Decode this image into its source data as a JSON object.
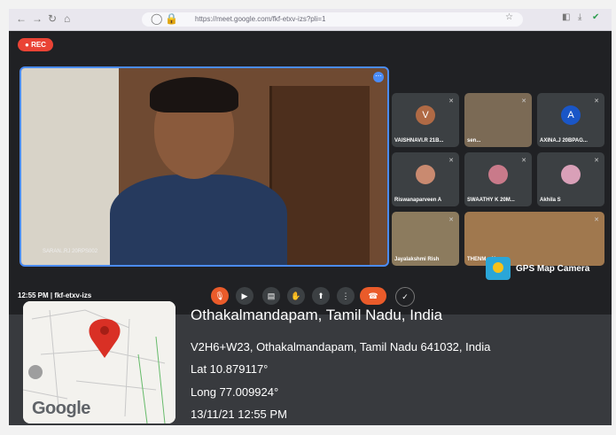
{
  "browser": {
    "url": "https://meet.google.com/fkf-etxv-izs?pli=1"
  },
  "meeting": {
    "rec_label": "REC",
    "time": "12:55 PM",
    "separator": "|",
    "code": "fkf-etxv-izs",
    "main_speaker_name": "SARAN..RJ 20RPS002",
    "participants": [
      {
        "name": "VAISHNAVI.R 21B...",
        "initial": "V",
        "avatar_color": "#b06a45"
      },
      {
        "name": "sen...",
        "initial": "",
        "avatar_color": ""
      },
      {
        "name": "AXINA.J 20BPAG...",
        "initial": "A",
        "avatar_color": "#1a56c7"
      },
      {
        "name": "Riswanaparveen A",
        "initial": "",
        "avatar_color": ""
      },
      {
        "name": "SWAATHY K 20M...",
        "initial": "",
        "avatar_color": ""
      },
      {
        "name": "Akhila S",
        "initial": "",
        "avatar_color": ""
      },
      {
        "name": "Jayalakshmi Rish",
        "initial": "",
        "avatar_color": ""
      },
      {
        "name": "THENM... You",
        "initial": "",
        "avatar_color": ""
      }
    ],
    "mic_off_icon": "mic-off-icon"
  },
  "gps_badge": {
    "label": "GPS Map Camera"
  },
  "location": {
    "title": "Othakalmandapam, Tamil Nadu, India",
    "address": "V2H6+W23, Othakalmandapam, Tamil Nadu 641032, India",
    "lat": "Lat 10.879117°",
    "long": "Long 77.009924°",
    "datetime": "13/11/21 12:55 PM",
    "map_brand": "Google"
  },
  "colors": {
    "rec": "#ea4335",
    "hangup": "#ea5b2a",
    "active_border": "#4b8cf7",
    "meet_bg": "#202124",
    "pin": "#d93025"
  }
}
